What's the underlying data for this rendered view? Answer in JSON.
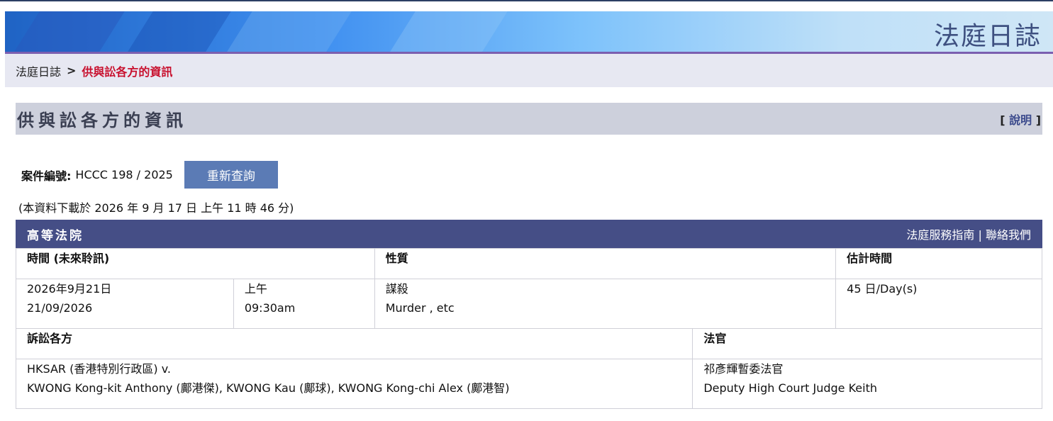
{
  "banner": {
    "title": "法庭日誌"
  },
  "breadcrumb": {
    "home": "法庭日誌",
    "separator": ">",
    "current": "供與訟各方的資訊"
  },
  "page": {
    "heading": "供與訟各方的資訊",
    "help_open": "[",
    "help_label": "說明",
    "help_close": "]"
  },
  "case": {
    "label": "案件編號:",
    "number": "HCCC 198 / 2025",
    "requery_label": "重新查詢"
  },
  "download_note": "(本資料下載於 2026 年 9 月 17 日 上午 11 時 46 分)",
  "court": {
    "name": "高等法院",
    "guide_link": "法庭服務指南",
    "divider": "|",
    "contact_link": "聯絡我們"
  },
  "hearing": {
    "headers": {
      "time": "時間 (未來聆訊)",
      "nature": "性質",
      "duration": "估計時間"
    },
    "date_zh": "2026年9月21日",
    "date_en": "21/09/2026",
    "session_zh": "上午",
    "time": "09:30am",
    "nature_zh": "謀殺",
    "nature_en": "Murder , etc",
    "duration": "45 日/Day(s)"
  },
  "parties": {
    "headers": {
      "parties": "訴訟各方",
      "judge": "法官"
    },
    "line1": "HKSAR (香港特別行政區) v.",
    "line2": "KWONG Kong-kit Anthony (鄺港傑), KWONG Kau (鄺球), KWONG Kong-chi Alex (鄺港智)",
    "judge_zh": "祁彥輝暫委法官",
    "judge_en": "Deputy High Court Judge Keith"
  },
  "colors": {
    "court_bar": "#454e86",
    "breadcrumb_current": "#c8102e",
    "requery_button": "#5b7bb5",
    "heading_bg": "#cdd0dc"
  }
}
